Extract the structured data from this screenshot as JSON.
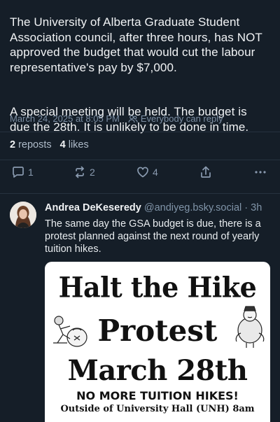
{
  "post": {
    "paragraph1": "The University of Alberta Graduate Student Association council, after three hours, has NOT approved the budget that would cut the labour representative's pay by $7,000.",
    "paragraph2": "A special meeting will  be held. The budget is due the 28th. It is unlikely to be done in time.",
    "timestamp": "March 24, 2025 at 8:05 PM",
    "reply_setting": "Everybody can reply",
    "reposts_count": "2",
    "reposts_label": "reposts",
    "likes_count": "4",
    "likes_label": "likes"
  },
  "actions": {
    "reply_count": "1",
    "repost_count": "2",
    "like_count": "4"
  },
  "reply": {
    "display_name": "Andrea DeKeseredy",
    "handle": "@andiyeg.bsky.social",
    "separator": "·",
    "time": "3h",
    "text": "The same day the GSA budget is due, there is a protest planned against the next round of yearly tuition hikes."
  },
  "poster": {
    "title": "Halt the Hike",
    "line2": "Protest",
    "date": "March 28th",
    "subtitle": "NO MORE TUITION HIKES!",
    "location": "Outside of University Hall (UNH) 8am"
  },
  "icons": {
    "reply": "reply-bubble-icon",
    "repost": "repost-icon",
    "like": "heart-icon",
    "share": "share-icon",
    "more": "more-dots-icon",
    "audience": "people-icon"
  },
  "colors": {
    "background": "#151e28",
    "muted": "#7b8ea3",
    "text": "#f1f3f5"
  }
}
